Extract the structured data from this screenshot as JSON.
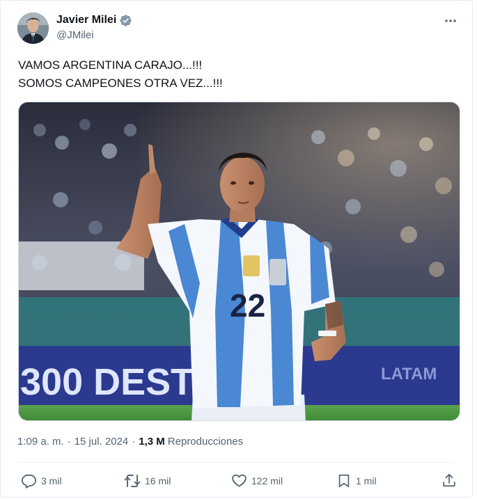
{
  "author": {
    "name": "Javier Milei",
    "handle": "@JMilei",
    "verified": true,
    "verified_color": "#829aab"
  },
  "icons": {
    "verified": "verified-badge-icon",
    "more": "more-options-icon",
    "reply": "reply-icon",
    "retweet": "retweet-icon",
    "like": "like-icon",
    "bookmark": "bookmark-icon",
    "share": "share-icon"
  },
  "tweet": {
    "lines": [
      "VAMOS ARGENTINA CARAJO...!!!",
      "SOMOS CAMPEONES OTRA VEZ...!!!"
    ],
    "media": {
      "banner_left": "300 DEST",
      "banner_right": "LATAM",
      "jersey_number": "22"
    }
  },
  "meta": {
    "time": "1:09 a. m.",
    "date": "15 jul. 2024",
    "separator": "·",
    "views_count": "1,3 M",
    "views_label": "Reproducciones"
  },
  "actions": {
    "replies": "3 mil",
    "retweets": "16 mil",
    "likes": "122 mil",
    "bookmarks": "1 mil"
  },
  "colors": {
    "text": "#0f1419",
    "secondary": "#536471",
    "divider": "#eff3f4"
  }
}
